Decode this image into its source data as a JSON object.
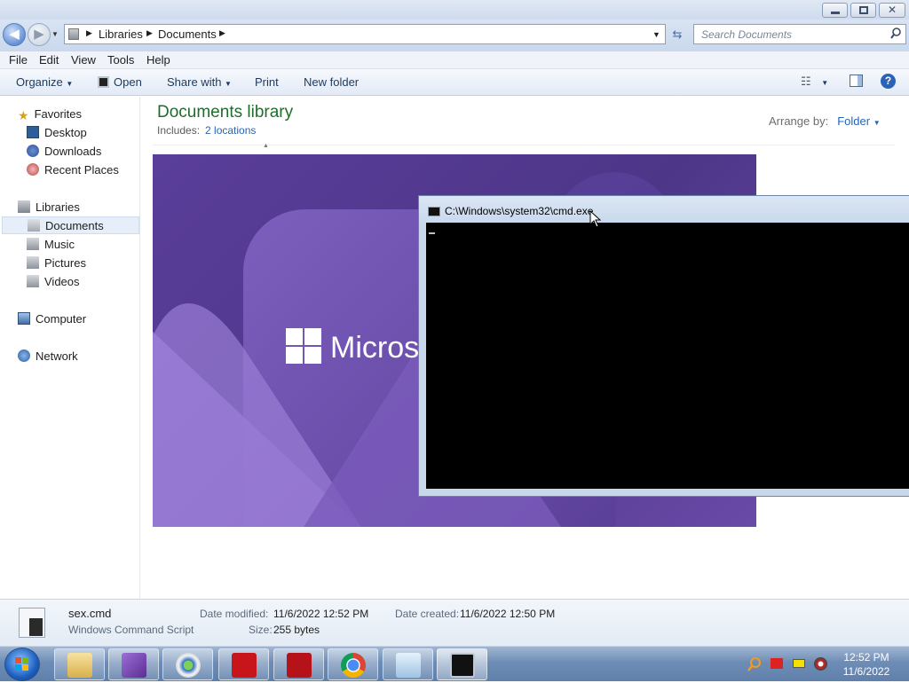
{
  "explorer": {
    "address": {
      "crumbs": [
        "Libraries",
        "Documents"
      ]
    },
    "search": {
      "placeholder": "Search Documents"
    },
    "menu": [
      "File",
      "Edit",
      "View",
      "Tools",
      "Help"
    ],
    "commands": {
      "organize": "Organize",
      "open": "Open",
      "share_with": "Share with",
      "print": "Print",
      "new_folder": "New folder"
    },
    "nav": {
      "favorites": {
        "label": "Favorites",
        "items": [
          "Desktop",
          "Downloads",
          "Recent Places"
        ]
      },
      "libraries": {
        "label": "Libraries",
        "items": [
          "Documents",
          "Music",
          "Pictures",
          "Videos"
        ],
        "selected": "Documents"
      },
      "computer": "Computer",
      "network": "Network"
    },
    "library": {
      "title": "Documents library",
      "includes_label": "Includes:",
      "includes_link": "2 locations",
      "arrange_label": "Arrange by:",
      "arrange_value": "Folder"
    },
    "details": {
      "filename": "sex.cmd",
      "filetype": "Windows Command Script",
      "date_modified_label": "Date modified:",
      "date_modified": "11/6/2022 12:52 PM",
      "size_label": "Size:",
      "size": "255 bytes",
      "date_created_label": "Date created:",
      "date_created": "11/6/2022 12:50 PM"
    }
  },
  "wallpaper": {
    "text": "Micros"
  },
  "cmd_window": {
    "title": "C:\\Windows\\system32\\cmd.exe"
  },
  "taskbar": {
    "apps": [
      "windows-explorer",
      "visual-studio",
      "media-center",
      "adobe-acrobat",
      "adobe-reader",
      "google-chrome",
      "notepad",
      "command-prompt"
    ],
    "clock": {
      "time": "12:52 PM",
      "date": "11/6/2022"
    }
  },
  "colors": {
    "library_title": "#1e6e2a",
    "link": "#2266bb",
    "wallpaper_purple": "#4d3688",
    "console_bg": "#000000"
  }
}
